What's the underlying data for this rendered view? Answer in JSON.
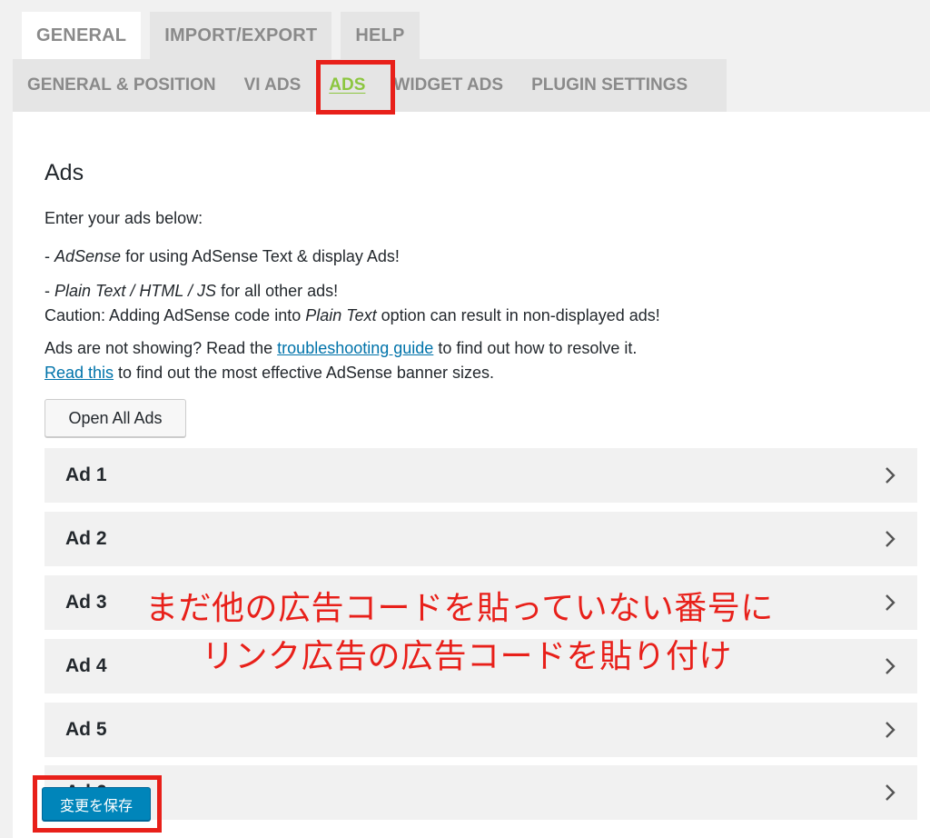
{
  "top_tabs": [
    {
      "label": "GENERAL",
      "active": true
    },
    {
      "label": "IMPORT/EXPORT",
      "active": false
    },
    {
      "label": "HELP",
      "active": false
    }
  ],
  "sub_tabs": [
    {
      "label": "GENERAL & POSITION",
      "active": false
    },
    {
      "label": "VI ADS",
      "active": false
    },
    {
      "label": "ADS",
      "active": true
    },
    {
      "label": "WIDGET ADS",
      "active": false
    },
    {
      "label": "PLUGIN SETTINGS",
      "active": false
    }
  ],
  "section": {
    "title": "Ads",
    "intro": "Enter your ads below:",
    "adsense_prefix": "- ",
    "adsense_em": "AdSense",
    "adsense_rest": " for using AdSense Text & display Ads!",
    "plain_prefix": "- ",
    "plain_em": "Plain Text / HTML / JS",
    "plain_rest": " for all other ads!",
    "caution_pre": "Caution: Adding AdSense code into ",
    "caution_em": "Plain Text",
    "caution_post": " option can result in non-displayed ads!",
    "trouble_pre": "Ads are not showing? Read the ",
    "trouble_link": "troubleshooting guide",
    "trouble_post": " to find out how to resolve it.",
    "readthis_link": "Read this",
    "readthis_post": " to find out the most effective AdSense banner sizes."
  },
  "open_all_label": "Open All Ads",
  "ads": [
    {
      "label": "Ad 1"
    },
    {
      "label": "Ad 2"
    },
    {
      "label": "Ad 3"
    },
    {
      "label": "Ad 4"
    },
    {
      "label": "Ad 5"
    },
    {
      "label": "Ad 6"
    }
  ],
  "annotation": {
    "line1": "まだ他の広告コードを貼っていない番号に",
    "line2": "リンク広告の広告コードを貼り付け"
  },
  "save_label": "変更を保存",
  "colors": {
    "active_subtab": "#8cc63f",
    "highlight_box": "#e8201a",
    "primary_button": "#0085ba",
    "link": "#0073aa"
  }
}
